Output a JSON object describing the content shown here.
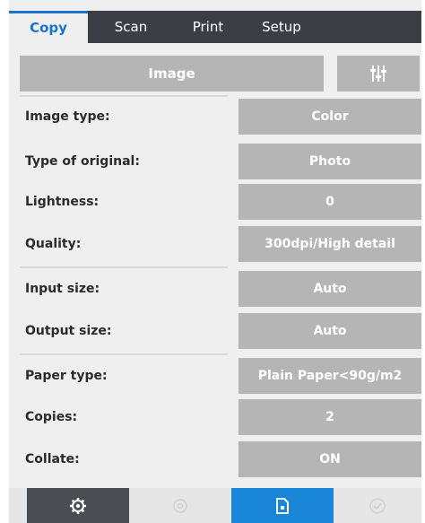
{
  "tabs": [
    {
      "label": "Copy",
      "active": true
    },
    {
      "label": "Scan",
      "active": false
    },
    {
      "label": "Print",
      "active": false
    },
    {
      "label": "Setup",
      "active": false
    }
  ],
  "section": {
    "image_label": "Image",
    "adjust_icon": "sliders-icon"
  },
  "settings": [
    {
      "label": "Image type:",
      "value": "Color"
    },
    {
      "label": "Type of original:",
      "value": "Photo"
    },
    {
      "label": "Lightness:",
      "value": "0"
    },
    {
      "label": "Quality:",
      "value": "300dpi/High detail"
    },
    {
      "label": "Input size:",
      "value": "Auto"
    },
    {
      "label": "Output size:",
      "value": "Auto"
    },
    {
      "label": "Paper type:",
      "value": "Plain Paper<90g/m2"
    },
    {
      "label": "Copies:",
      "value": "2"
    },
    {
      "label": "Collate:",
      "value": "ON"
    }
  ],
  "bottom_bar": [
    {
      "icon": "gear-icon",
      "state": "active-dark"
    },
    {
      "icon": "stop-icon",
      "state": "disabled"
    },
    {
      "icon": "preview-document-icon",
      "state": "primary"
    },
    {
      "icon": "checkmark-icon",
      "state": "disabled"
    }
  ],
  "colors": {
    "tab_bar": "#3b3f45",
    "accent_blue": "#1a73c8",
    "button_gray": "#b5b5b5",
    "panel_bg": "#efefef",
    "settings_button_dark": "#4a4d52"
  }
}
